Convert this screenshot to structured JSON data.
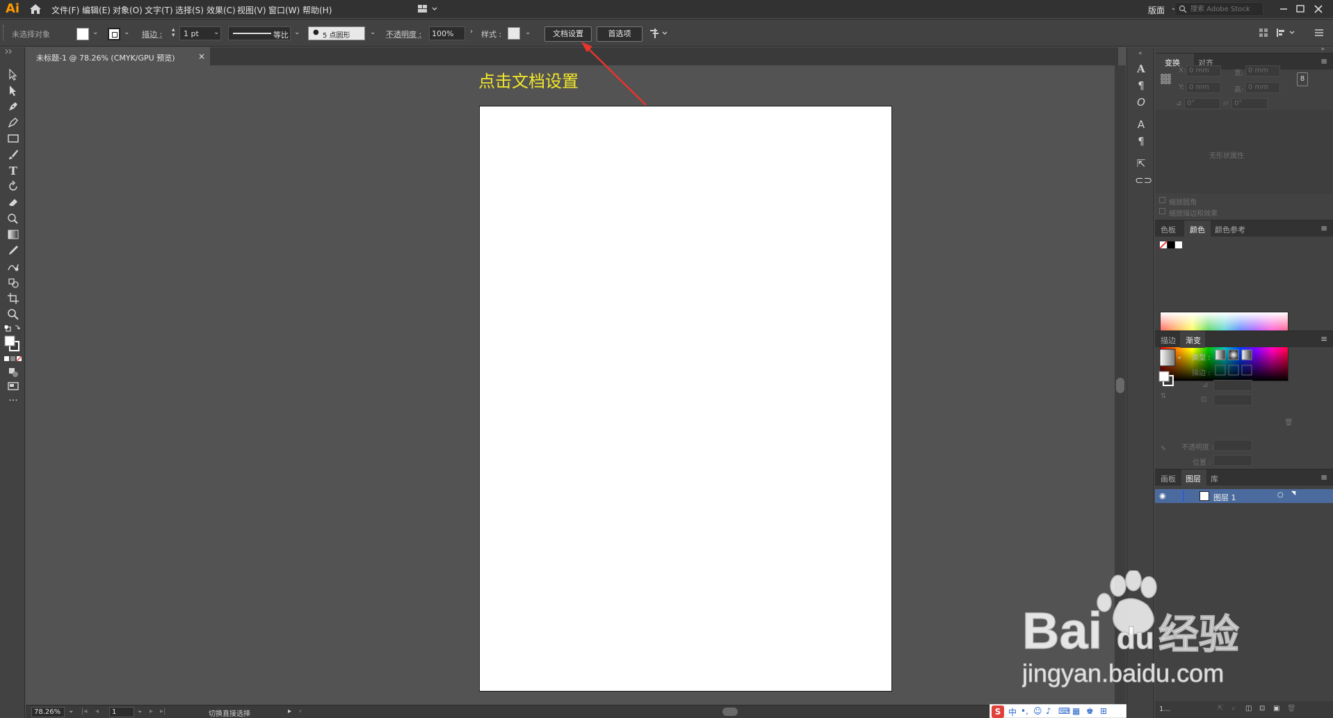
{
  "app": {
    "logo": "Ai",
    "menus": [
      "文件(F)",
      "编辑(E)",
      "对象(O)",
      "文字(T)",
      "选择(S)",
      "效果(C)",
      "视图(V)",
      "窗口(W)",
      "帮助(H)"
    ],
    "workspace": "版面",
    "search_placeholder": "搜索 Adobe Stock"
  },
  "control_bar": {
    "selection_status": "未选择对象",
    "stroke_label": "描边 :",
    "stroke_weight": "1 pt",
    "stroke_profile": "等比",
    "brush": "5 点圆形",
    "opacity_label": "不透明度 :",
    "opacity_value": "100%",
    "style_label": "样式 :",
    "doc_setup_button": "文档设置",
    "preferences_button": "首选项"
  },
  "document": {
    "tab_title": "未标题-1 @ 78.26% (CMYK/GPU 预览)"
  },
  "annotation": {
    "text": "点击文档设置",
    "color": "#f3e82a",
    "arrow_color": "#e8342c"
  },
  "status_bar": {
    "zoom": "78.26%",
    "page": "1",
    "tool_hint": "切换直接选择"
  },
  "panels": {
    "transform": {
      "tabs": [
        "变换",
        "对齐"
      ],
      "x_label": "X:",
      "y_label": "Y:",
      "w_label": "宽:",
      "h_label": "高:",
      "x": "0 mm",
      "y": "0 mm",
      "w": "0 mm",
      "h": "0 mm",
      "angle": "0°",
      "shear": "0°",
      "no_shape": "无形状属性",
      "scale_corners": "缩放圆角",
      "scale_strokes": "缩放描边和效果"
    },
    "color": {
      "tabs": [
        "色板",
        "颜色",
        "颜色参考"
      ]
    },
    "gradient": {
      "tabs": [
        "描边",
        "渐变"
      ],
      "type_label": "类型 :",
      "stroke_label": "描边 :",
      "opacity_label": "不透明度 :",
      "location_label": "位置 :"
    },
    "layers": {
      "tabs": [
        "画板",
        "图层",
        "库"
      ],
      "layer_name": "图层 1",
      "footer_count": "1..."
    }
  },
  "ime": {
    "logo": "S",
    "lang": "中"
  },
  "watermark": {
    "brand_top": "Bai",
    "brand_mid": "du",
    "brand_cn": "经验",
    "url": "jingyan.baidu.com"
  }
}
